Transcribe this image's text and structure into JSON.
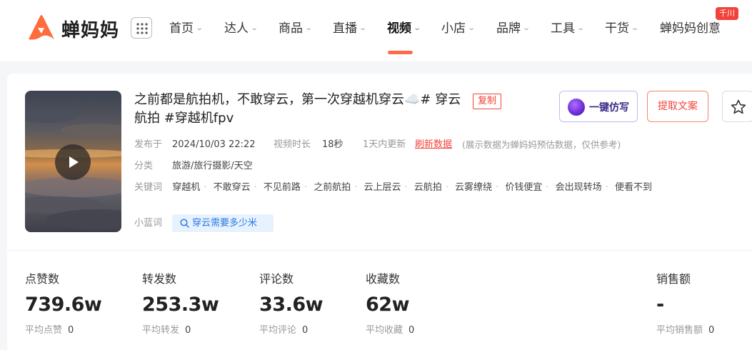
{
  "colors": {
    "accent": "#ff6b4a",
    "red": "#f2423a",
    "blue": "#2a7ae2",
    "ai_purple": "#6b2bd6"
  },
  "header": {
    "logo_text": "蝉妈妈",
    "nav": [
      {
        "label": "首页",
        "dropdown": true
      },
      {
        "label": "达人",
        "dropdown": true
      },
      {
        "label": "商品",
        "dropdown": true
      },
      {
        "label": "直播",
        "dropdown": true
      },
      {
        "label": "视频",
        "dropdown": true,
        "active": true
      },
      {
        "label": "小店",
        "dropdown": true
      },
      {
        "label": "品牌",
        "dropdown": true
      },
      {
        "label": "工具",
        "dropdown": true
      },
      {
        "label": "干货",
        "dropdown": true
      },
      {
        "label": "蝉妈妈创意",
        "dropdown": false
      }
    ],
    "badge": "千川"
  },
  "video": {
    "title": "之前都是航拍机，不敢穿云，第一次穿越机穿云☁️# 穿云航拍 #穿越机fpv",
    "copy_tag": "复制",
    "publish_label": "发布于",
    "publish_time": "2024/10/03 22:22",
    "duration_label": "视频时长",
    "duration": "18秒",
    "update_note": "1天内更新",
    "refresh_link": "刷新数据",
    "estimate_note": "(展示数据为蝉妈妈预估数据，仅供参考)",
    "category_label": "分类",
    "category": "旅游/旅行摄影/天空",
    "keywords_label": "关键词",
    "keywords": [
      "穿越机",
      "不敢穿云",
      "不见前路",
      "之前航拍",
      "云上层云",
      "云航拍",
      "云雾缭绕",
      "价钱便宜",
      "会出现转场",
      "便看不到"
    ],
    "blue_word_label": "小蓝词",
    "blue_word": "穿云需要多少米"
  },
  "actions": {
    "ai_copy": "一键仿写",
    "extract_text": "提取文案"
  },
  "stats": [
    {
      "label": "点赞数",
      "value": "739.6w",
      "avg_label": "平均点赞",
      "avg": "0"
    },
    {
      "label": "转发数",
      "value": "253.3w",
      "avg_label": "平均转发",
      "avg": "0"
    },
    {
      "label": "评论数",
      "value": "33.6w",
      "avg_label": "平均评论",
      "avg": "0"
    },
    {
      "label": "收藏数",
      "value": "62w",
      "avg_label": "平均收藏",
      "avg": "0"
    },
    {
      "label": "销售额",
      "value": "-",
      "avg_label": "平均销售额",
      "avg": "0"
    }
  ]
}
